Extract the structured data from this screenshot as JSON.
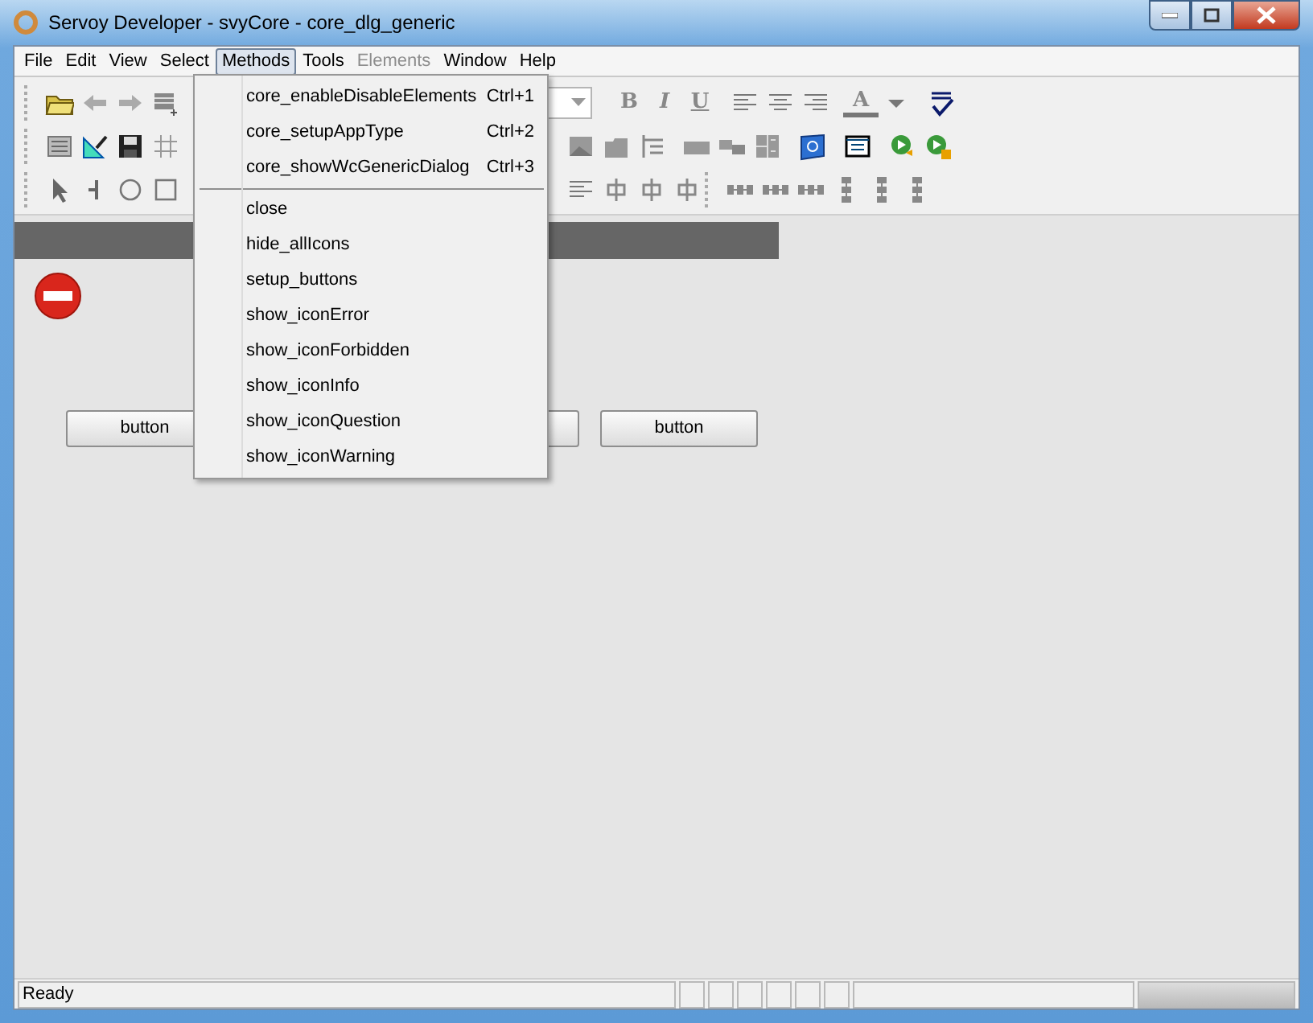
{
  "window": {
    "title": "Servoy Developer - svyCore - core_dlg_generic"
  },
  "menubar": [
    {
      "label": "File",
      "selected": false,
      "disabled": false
    },
    {
      "label": "Edit",
      "selected": false,
      "disabled": false
    },
    {
      "label": "View",
      "selected": false,
      "disabled": false
    },
    {
      "label": "Select",
      "selected": false,
      "disabled": false
    },
    {
      "label": "Methods",
      "selected": true,
      "disabled": false
    },
    {
      "label": "Tools",
      "selected": false,
      "disabled": false
    },
    {
      "label": "Elements",
      "selected": false,
      "disabled": true
    },
    {
      "label": "Window",
      "selected": false,
      "disabled": false
    },
    {
      "label": "Help",
      "selected": false,
      "disabled": false
    }
  ],
  "toolbar": {
    "format_glyphs": [
      "B",
      "I",
      "U"
    ],
    "font_color_glyph": "A"
  },
  "methods_menu": [
    {
      "kind": "item",
      "label": "core_enableDisableElements",
      "shortcut": "Ctrl+1"
    },
    {
      "kind": "item",
      "label": "core_setupAppType",
      "shortcut": "Ctrl+2"
    },
    {
      "kind": "item",
      "label": "core_showWcGenericDialog",
      "shortcut": "Ctrl+3"
    },
    {
      "kind": "separator"
    },
    {
      "kind": "item",
      "label": "close"
    },
    {
      "kind": "item",
      "label": "hide_allIcons"
    },
    {
      "kind": "item",
      "label": "setup_buttons"
    },
    {
      "kind": "item",
      "label": "show_iconError"
    },
    {
      "kind": "item",
      "label": "show_iconForbidden"
    },
    {
      "kind": "item",
      "label": "show_iconInfo"
    },
    {
      "kind": "item",
      "label": "show_iconQuestion"
    },
    {
      "kind": "item",
      "label": "show_iconWarning"
    }
  ],
  "form": {
    "buttons": [
      "button",
      "button"
    ]
  },
  "status_bar": {
    "text": "Ready",
    "progress": {
      "level": 1
    }
  }
}
